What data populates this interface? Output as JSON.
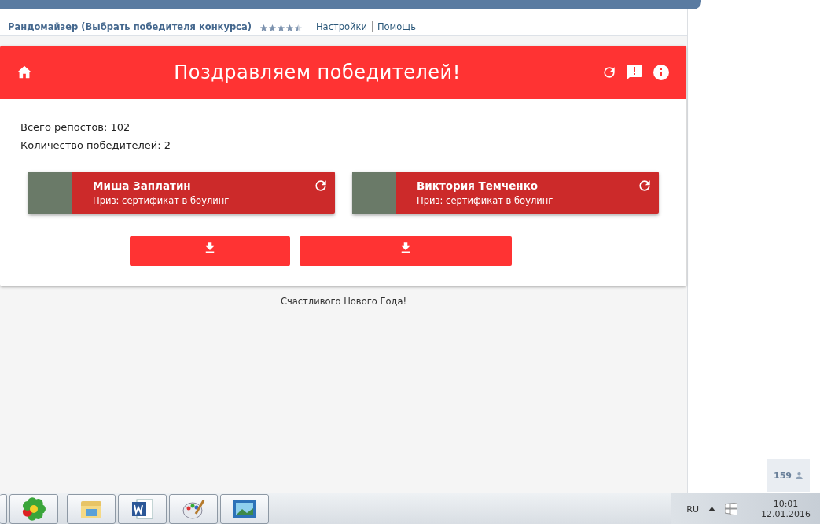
{
  "app_header": {
    "title": "Рандомайзер (Выбрать победителя конкурса)",
    "stars": 4.5,
    "links": [
      "Настройки",
      "Помощь"
    ]
  },
  "banner": {
    "title": "Поздравляем победителей!"
  },
  "stats": [
    "Всего репостов: 102",
    "Количество победителей: 2"
  ],
  "winners": [
    {
      "name": "Миша Заплатин",
      "prize": "Приз: сертификат в боулинг"
    },
    {
      "name": "Виктория Темченко",
      "prize": "Приз: сертификат в боулинг"
    }
  ],
  "footer": "Счастливого Нового Года!",
  "side_counter": "159",
  "taskbar": {
    "language": "RU",
    "time": "10:01",
    "date": "12.01.2016"
  }
}
